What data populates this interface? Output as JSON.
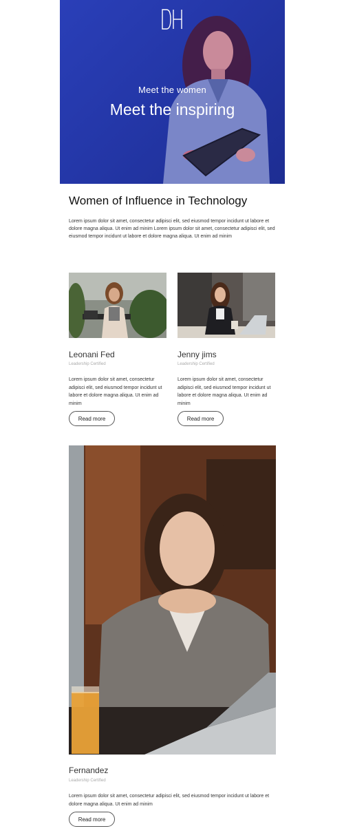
{
  "hero": {
    "subtitle": "Meet the women",
    "title": "Meet the inspiring"
  },
  "intro": {
    "title": "Women of Influence in Technology",
    "body": "Lorem ipsum dolor sit amet, consectetur adipisci elit, sed eiusmod tempor incidunt ut labore et dolore magna aliqua. Ut enim ad minim  Lorem ipsum dolor sit amet, consectetur adipisci elit, sed eiusmod tempor incidunt ut labore et dolore magna aliqua. Ut enim ad minim"
  },
  "cards": [
    {
      "name": "Leonani Fed",
      "role": "Leadership Certified",
      "description": "Lorem ipsum dolor sit amet, consectetur adipisci elit, sed eiusmod tempor incidunt ut labore et dolore magna aliqua. Ut enim ad minim",
      "button": "Read more"
    },
    {
      "name": "Jenny jims",
      "role": "Leadership Certified",
      "description": "Lorem ipsum dolor sit amet, consectetur adipisci elit, sed eiusmod tempor incidunt ut labore et dolore magna aliqua. Ut enim ad minim",
      "button": "Read more"
    }
  ],
  "featured": {
    "name": "Fernandez",
    "role": "Leadership Certified",
    "description": "Lorem ipsum dolor sit amet, consectetur adipisci elit, sed eiusmod tempor incidunt ut labore et dolore magna aliqua. Ut enim ad minim",
    "button": "Read more"
  }
}
